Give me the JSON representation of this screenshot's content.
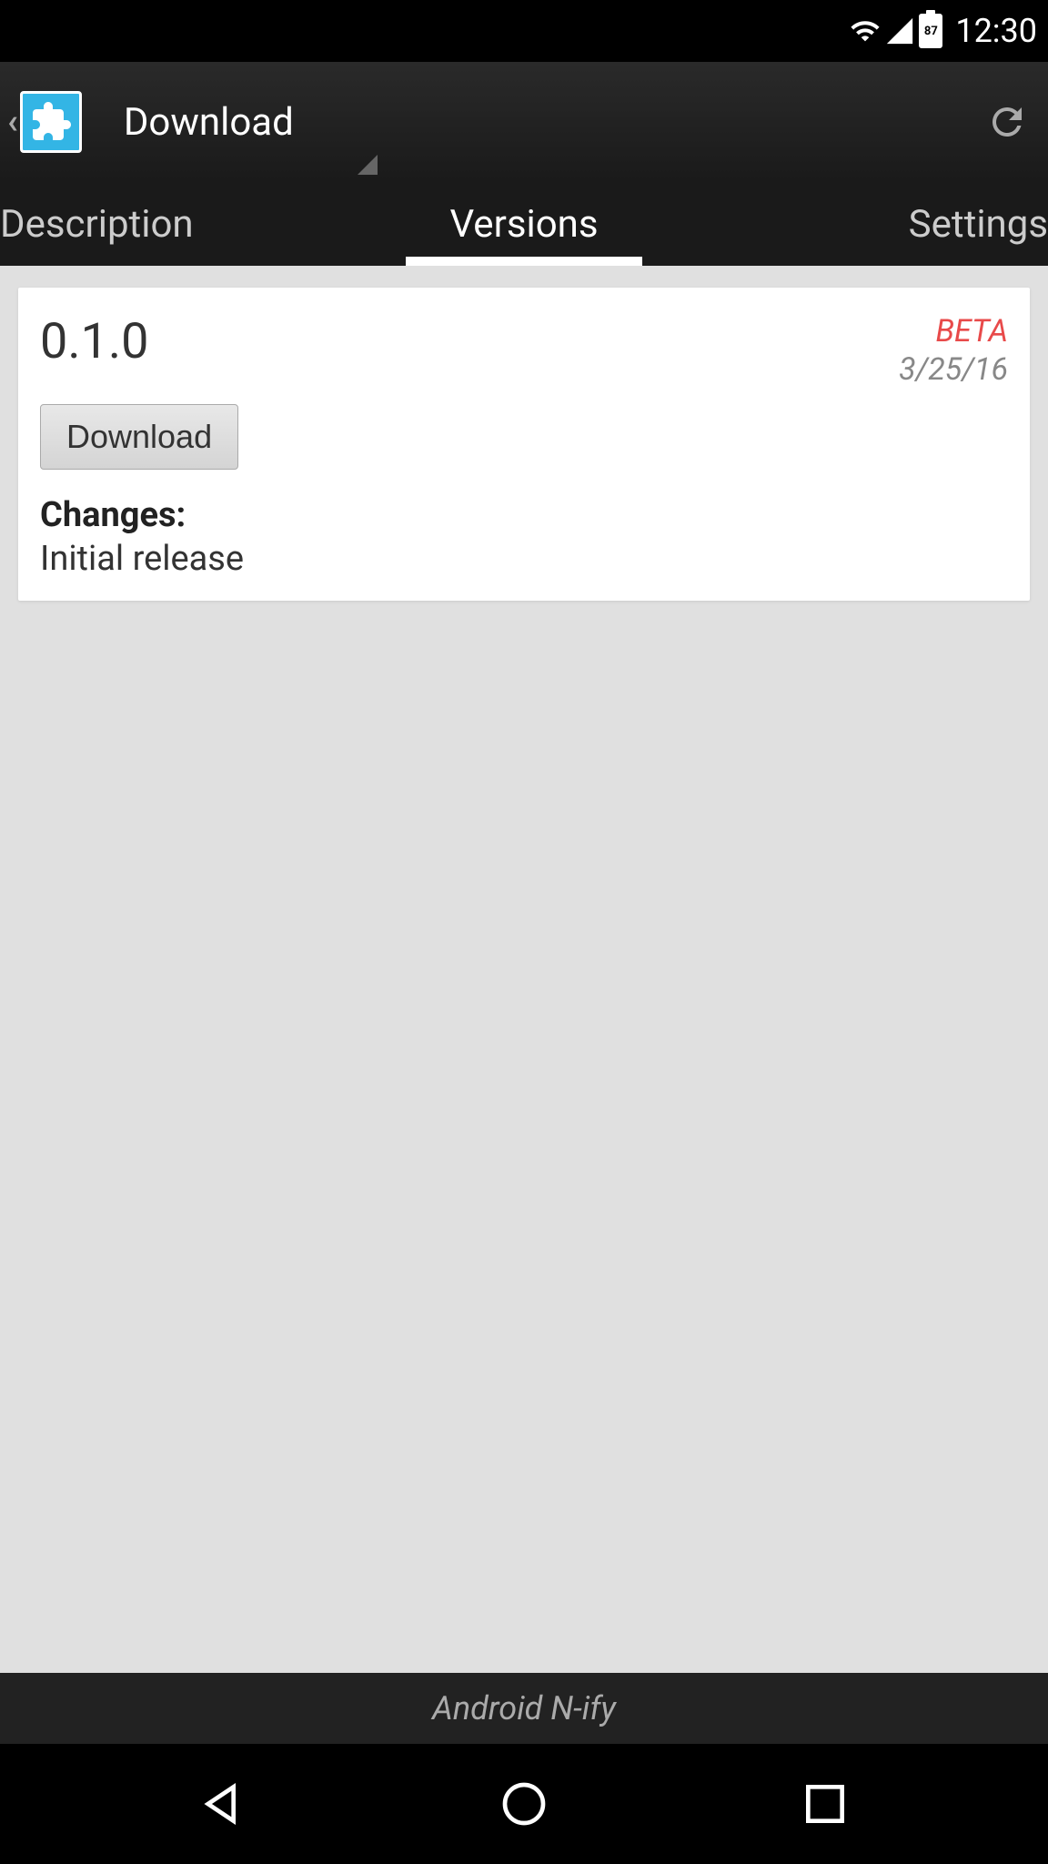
{
  "status_bar": {
    "battery_level": "87",
    "time": "12:30"
  },
  "app_bar": {
    "title": "Download"
  },
  "tabs": {
    "description": "Description",
    "versions": "Versions",
    "settings": "Settings"
  },
  "version_card": {
    "version": "0.1.0",
    "beta_label": "BETA",
    "date": "3/25/16",
    "download_button": "Download",
    "changes_label": "Changes:",
    "changes_text": "Initial release"
  },
  "footer": {
    "text": "Android N-ify"
  }
}
